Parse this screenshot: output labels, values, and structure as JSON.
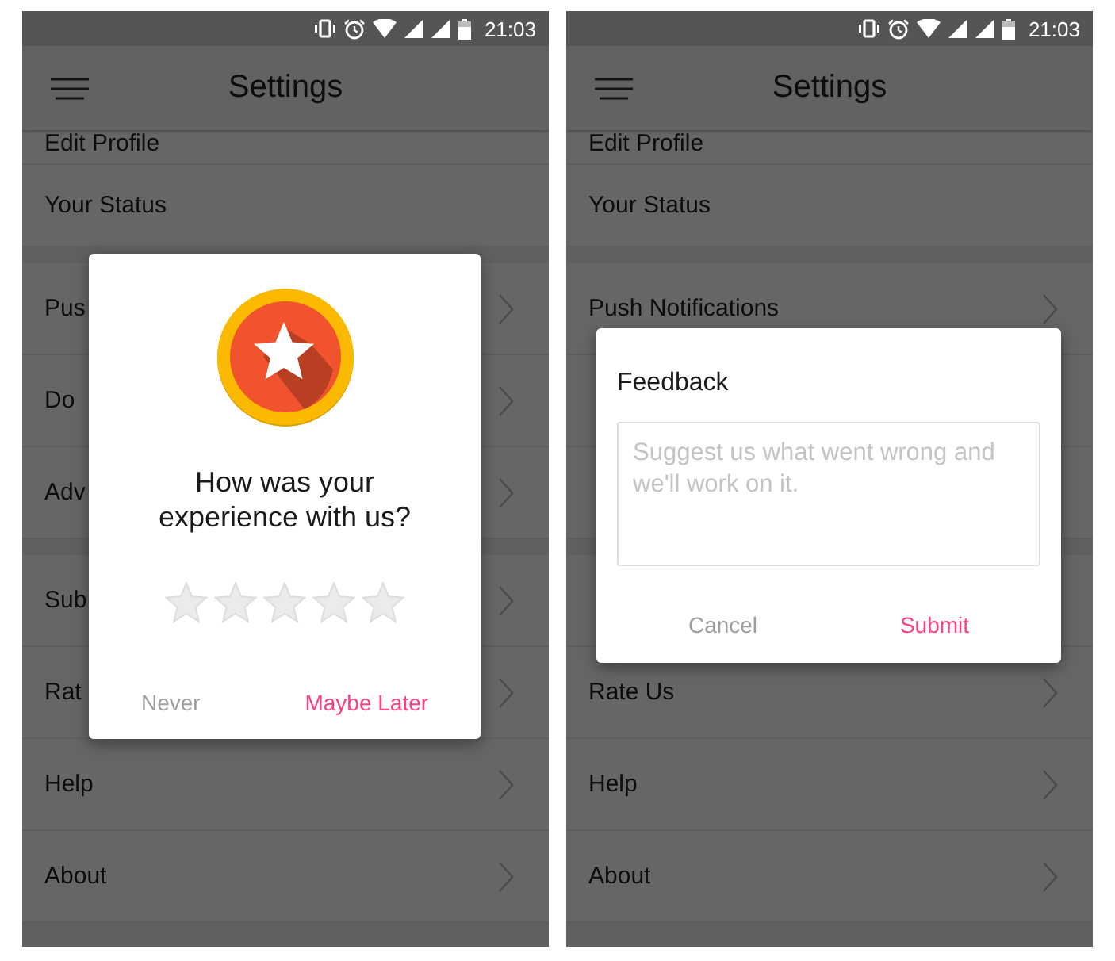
{
  "screens": [
    {
      "status_bar": {
        "time": "21:03"
      },
      "app_bar": {
        "title": "Settings"
      },
      "groups": [
        {
          "rows": [
            {
              "label": "Edit Profile",
              "chevron": false
            },
            {
              "label": "Your Status",
              "chevron": false
            }
          ]
        },
        {
          "rows": [
            {
              "label": "Pus",
              "chevron": true
            },
            {
              "label": "Do",
              "chevron": true
            },
            {
              "label": "Adv",
              "chevron": true
            }
          ]
        },
        {
          "rows": [
            {
              "label": "Sub",
              "chevron": true
            },
            {
              "label": "Rat",
              "chevron": true
            },
            {
              "label": "Help",
              "chevron": true
            },
            {
              "label": "About",
              "chevron": true
            }
          ]
        }
      ],
      "dialog": {
        "kind": "rating",
        "question": "How was your experience with us?",
        "stars": 0,
        "buttons": [
          {
            "label": "Never",
            "kind": "secondary"
          },
          {
            "label": "Maybe Later",
            "kind": "primary"
          }
        ]
      }
    },
    {
      "status_bar": {
        "time": "21:03"
      },
      "app_bar": {
        "title": "Settings"
      },
      "groups": [
        {
          "rows": [
            {
              "label": "Edit Profile",
              "chevron": false
            },
            {
              "label": "Your Status",
              "chevron": false
            }
          ]
        },
        {
          "rows": [
            {
              "label": "Push Notifications",
              "chevron": true
            },
            {
              "chevron": false
            },
            {
              "chevron": false
            }
          ]
        },
        {
          "rows": [
            {
              "chevron": false
            },
            {
              "label": "Rate Us",
              "chevron": true
            },
            {
              "label": "Help",
              "chevron": true
            },
            {
              "label": "About",
              "chevron": true
            }
          ]
        }
      ],
      "dialog": {
        "kind": "feedback",
        "title": "Feedback",
        "field": {
          "placeholder": "Suggest us what went wrong and we'll work on it."
        },
        "buttons": [
          {
            "label": "Cancel",
            "kind": "secondary"
          },
          {
            "label": "Submit",
            "kind": "primary"
          }
        ]
      }
    }
  ]
}
